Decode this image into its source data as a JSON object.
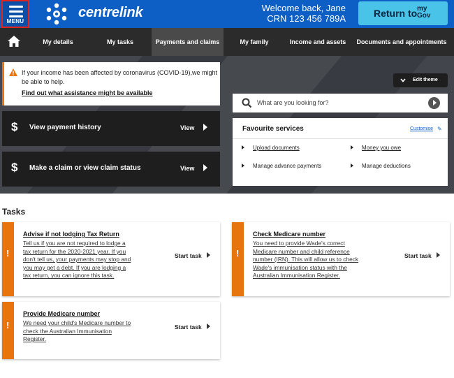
{
  "header": {
    "menu_label": "MENU",
    "brand": "centrelink",
    "welcome": "Welcome back, Jane",
    "crn": "CRN 123 456 789A",
    "return_label": "Return to",
    "mygov_label_1": "my",
    "mygov_label_2": "Gov"
  },
  "nav": {
    "items": [
      {
        "label": "My details"
      },
      {
        "label": "My tasks"
      },
      {
        "label": "Payments and claims"
      },
      {
        "label": "My family"
      },
      {
        "label": "Income and assets"
      },
      {
        "label": "Documents and appointments"
      }
    ],
    "active": "Payments and claims"
  },
  "alert": {
    "text": "If your income has been affected by coronavirus (COVID-19),we might be able to help.",
    "link": "Find out what assistance might be available"
  },
  "cards": [
    {
      "title": "View payment history",
      "action": "View"
    },
    {
      "title": "Make a claim or view claim status",
      "action": "View"
    }
  ],
  "edit_theme": "Edit theme",
  "search": {
    "placeholder": "What are you looking for?"
  },
  "favourites": {
    "title": "Favourite services",
    "customise": "Customise",
    "items": [
      "Upload documents",
      "Money you owe",
      "Manage advance payments",
      "Manage deductions"
    ]
  },
  "tasks": {
    "heading": "Tasks",
    "start_label": "Start task",
    "items": [
      {
        "title": "Advise if not lodging Tax Return",
        "lines": [
          "Tell us if you are not required to lodge a",
          "tax return for the 2020-2021 year. If you",
          "don't tell us, your payments may stop and",
          "you may get a debt. If you are lodging a",
          "tax return, you can ignore this task."
        ]
      },
      {
        "title": "Check Medicare number",
        "lines": [
          "You need to provide Wade's correct",
          "Medicare number and child reference",
          "number (IRN). This will allow us to check",
          "Wade's immunisation status with the",
          "Australian Immunisation Register."
        ]
      },
      {
        "title": "Provide Medicare number",
        "lines": [
          "We need your child's Medicare number to",
          "check the Australian Immunisation",
          "Register."
        ]
      }
    ]
  },
  "colors": {
    "brand_blue": "#0d5fc6",
    "mygov": "#49c3e8",
    "nav_dark": "#2b2b2b",
    "warning_orange": "#e8740e"
  }
}
